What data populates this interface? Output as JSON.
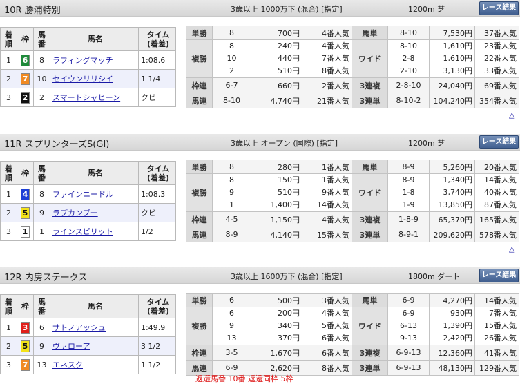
{
  "button_label": "レース結果",
  "up_arrow": "△",
  "order_headers": {
    "rank": "着\n順",
    "gate": "枠",
    "num": "馬\n番",
    "name": "馬名",
    "time": "タイム\n(着差)"
  },
  "races": [
    {
      "title": "10R 勝浦特別",
      "conditions": "3歳以上 1000万下 (混合) [指定]",
      "distance": "1200m  芝",
      "finishers": [
        {
          "rank": "1",
          "gate": "6",
          "gate_color": "#1f8a3b",
          "gate_text": "#ffffff",
          "num": "8",
          "name": "ラフィングマッチ",
          "time": "1:08.6"
        },
        {
          "rank": "2",
          "gate": "7",
          "gate_color": "#f08a24",
          "gate_text": "#ffffff",
          "num": "10",
          "name": "セイウンリリシイ",
          "time": "1 1/4"
        },
        {
          "rank": "3",
          "gate": "2",
          "gate_color": "#111111",
          "gate_text": "#ffffff",
          "num": "2",
          "name": "スマートシャヒーン",
          "time": "クビ"
        }
      ],
      "payouts": {
        "tansho": {
          "label": "単勝",
          "rows": [
            {
              "c": "8",
              "a": "700円",
              "p": "4番人気"
            }
          ]
        },
        "fukusho": {
          "label": "複勝",
          "rows": [
            {
              "c": "8",
              "a": "240円",
              "p": "4番人気"
            },
            {
              "c": "10",
              "a": "440円",
              "p": "7番人気"
            },
            {
              "c": "2",
              "a": "510円",
              "p": "8番人気"
            }
          ]
        },
        "wakuren": {
          "label": "枠連",
          "rows": [
            {
              "c": "6-7",
              "a": "660円",
              "p": "2番人気"
            }
          ]
        },
        "umaren": {
          "label": "馬連",
          "rows": [
            {
              "c": "8-10",
              "a": "4,740円",
              "p": "21番人気"
            }
          ]
        },
        "umatan": {
          "label": "馬単",
          "rows": [
            {
              "c": "8-10",
              "a": "7,530円",
              "p": "37番人気"
            }
          ]
        },
        "wide": {
          "label": "ワイド",
          "rows": [
            {
              "c": "8-10",
              "a": "1,610円",
              "p": "23番人気"
            },
            {
              "c": "2-8",
              "a": "1,610円",
              "p": "22番人気"
            },
            {
              "c": "2-10",
              "a": "3,130円",
              "p": "33番人気"
            }
          ]
        },
        "sanrenpuku": {
          "label": "3連複",
          "rows": [
            {
              "c": "2-8-10",
              "a": "24,040円",
              "p": "69番人気"
            }
          ]
        },
        "sanrentan": {
          "label": "3連単",
          "rows": [
            {
              "c": "8-10-2",
              "a": "104,240円",
              "p": "354番人気"
            }
          ]
        }
      }
    },
    {
      "title": "11R スプリンターズS(GI)",
      "conditions": "3歳以上 オープン (国際) [指定]",
      "distance": "1200m  芝",
      "finishers": [
        {
          "rank": "1",
          "gate": "4",
          "gate_color": "#1c3fd6",
          "gate_text": "#ffffff",
          "num": "8",
          "name": "ファインニードル",
          "time": "1:08.3"
        },
        {
          "rank": "2",
          "gate": "5",
          "gate_color": "#f3e21b",
          "gate_text": "#111111",
          "num": "9",
          "name": "ラブカンプー",
          "time": "クビ"
        },
        {
          "rank": "3",
          "gate": "1",
          "gate_color": "#ffffff",
          "gate_text": "#111111",
          "num": "1",
          "name": "ラインスピリット",
          "time": "1/2"
        }
      ],
      "payouts": {
        "tansho": {
          "label": "単勝",
          "rows": [
            {
              "c": "8",
              "a": "280円",
              "p": "1番人気"
            }
          ]
        },
        "fukusho": {
          "label": "複勝",
          "rows": [
            {
              "c": "8",
              "a": "150円",
              "p": "1番人気"
            },
            {
              "c": "9",
              "a": "510円",
              "p": "9番人気"
            },
            {
              "c": "1",
              "a": "1,400円",
              "p": "14番人気"
            }
          ]
        },
        "wakuren": {
          "label": "枠連",
          "rows": [
            {
              "c": "4-5",
              "a": "1,150円",
              "p": "4番人気"
            }
          ]
        },
        "umaren": {
          "label": "馬連",
          "rows": [
            {
              "c": "8-9",
              "a": "4,140円",
              "p": "15番人気"
            }
          ]
        },
        "umatan": {
          "label": "馬単",
          "rows": [
            {
              "c": "8-9",
              "a": "5,260円",
              "p": "20番人気"
            }
          ]
        },
        "wide": {
          "label": "ワイド",
          "rows": [
            {
              "c": "8-9",
              "a": "1,340円",
              "p": "14番人気"
            },
            {
              "c": "1-8",
              "a": "3,740円",
              "p": "40番人気"
            },
            {
              "c": "1-9",
              "a": "13,850円",
              "p": "87番人気"
            }
          ]
        },
        "sanrenpuku": {
          "label": "3連複",
          "rows": [
            {
              "c": "1-8-9",
              "a": "65,370円",
              "p": "165番人気"
            }
          ]
        },
        "sanrentan": {
          "label": "3連単",
          "rows": [
            {
              "c": "8-9-1",
              "a": "209,620円",
              "p": "578番人気"
            }
          ]
        }
      }
    },
    {
      "title": "12R 内房ステークス",
      "conditions": "3歳以上 1600万下 (混合) [指定]",
      "distance": "1800m  ダート",
      "finishers": [
        {
          "rank": "1",
          "gate": "3",
          "gate_color": "#e0201b",
          "gate_text": "#ffffff",
          "num": "6",
          "name": "サトノアッシュ",
          "time": "1:49.9"
        },
        {
          "rank": "2",
          "gate": "5",
          "gate_color": "#f3e21b",
          "gate_text": "#111111",
          "num": "9",
          "name": "ヴァローア",
          "time": "3 1/2"
        },
        {
          "rank": "3",
          "gate": "7",
          "gate_color": "#f08a24",
          "gate_text": "#ffffff",
          "num": "13",
          "name": "エネスク",
          "time": "1 1/2"
        }
      ],
      "payouts": {
        "tansho": {
          "label": "単勝",
          "rows": [
            {
              "c": "6",
              "a": "500円",
              "p": "3番人気"
            }
          ]
        },
        "fukusho": {
          "label": "複勝",
          "rows": [
            {
              "c": "6",
              "a": "200円",
              "p": "4番人気"
            },
            {
              "c": "9",
              "a": "340円",
              "p": "5番人気"
            },
            {
              "c": "13",
              "a": "370円",
              "p": "6番人気"
            }
          ]
        },
        "wakuren": {
          "label": "枠連",
          "rows": [
            {
              "c": "3-5",
              "a": "1,670円",
              "p": "6番人気"
            }
          ]
        },
        "umaren": {
          "label": "馬連",
          "rows": [
            {
              "c": "6-9",
              "a": "2,620円",
              "p": "8番人気"
            }
          ]
        },
        "umatan": {
          "label": "馬単",
          "rows": [
            {
              "c": "6-9",
              "a": "4,270円",
              "p": "14番人気"
            }
          ]
        },
        "wide": {
          "label": "ワイド",
          "rows": [
            {
              "c": "6-9",
              "a": "930円",
              "p": "7番人気"
            },
            {
              "c": "6-13",
              "a": "1,390円",
              "p": "15番人気"
            },
            {
              "c": "9-13",
              "a": "2,420円",
              "p": "26番人気"
            }
          ]
        },
        "sanrenpuku": {
          "label": "3連複",
          "rows": [
            {
              "c": "6-9-13",
              "a": "12,360円",
              "p": "41番人気"
            }
          ]
        },
        "sanrentan": {
          "label": "3連単",
          "rows": [
            {
              "c": "6-9-13",
              "a": "48,130円",
              "p": "129番人気"
            }
          ]
        }
      },
      "note": "返還馬番  10番  返還同枠  5枠"
    }
  ]
}
